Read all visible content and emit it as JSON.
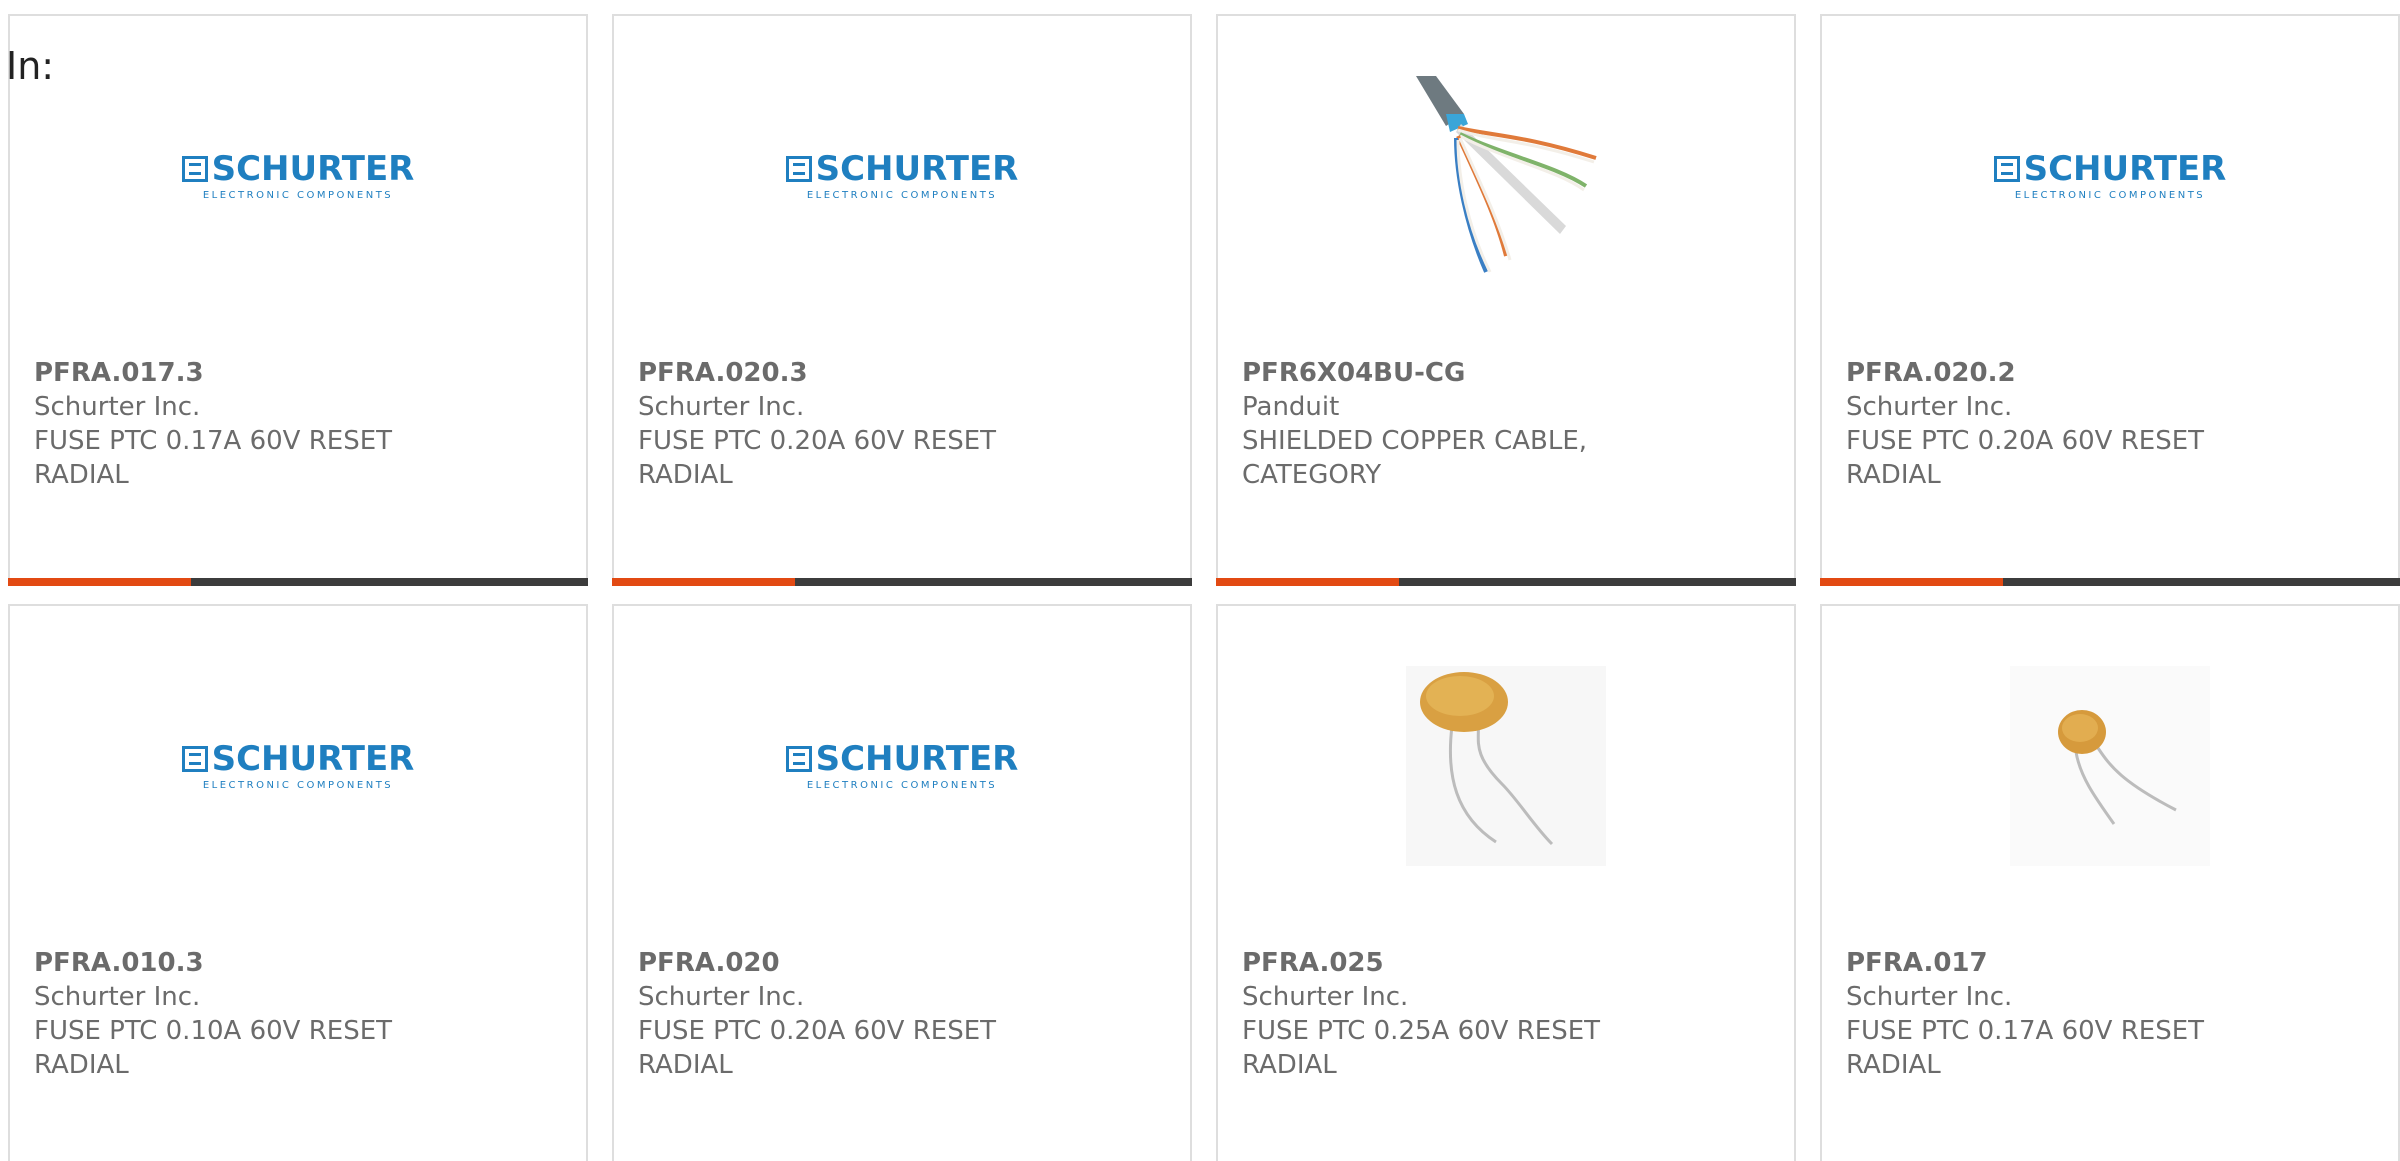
{
  "header": {
    "in_label": "In:"
  },
  "logo": {
    "name": "SCHURTER",
    "tagline": "ELECTRONIC COMPONENTS"
  },
  "colors": {
    "accent": "#e24a13",
    "bar": "#3c3c3c",
    "text": "#6b6b6b",
    "brand": "#1f7fc0"
  },
  "products": [
    {
      "part_number": "PFRA.017.3",
      "manufacturer": "Schurter Inc.",
      "description": "FUSE PTC 0.17A 60V RESET RADIAL",
      "image": "schurter-logo"
    },
    {
      "part_number": "PFRA.020.3",
      "manufacturer": "Schurter Inc.",
      "description": "FUSE PTC 0.20A 60V RESET RADIAL",
      "image": "schurter-logo"
    },
    {
      "part_number": "PFR6X04BU-CG",
      "manufacturer": "Panduit",
      "description": "SHIELDED COPPER CABLE, CATEGORY",
      "image": "cable-photo"
    },
    {
      "part_number": "PFRA.020.2",
      "manufacturer": "Schurter Inc.",
      "description": "FUSE PTC 0.20A 60V RESET RADIAL",
      "image": "schurter-logo"
    },
    {
      "part_number": "PFRA.010.3",
      "manufacturer": "Schurter Inc.",
      "description": "FUSE PTC 0.10A 60V RESET RADIAL",
      "image": "schurter-logo"
    },
    {
      "part_number": "PFRA.020",
      "manufacturer": "Schurter Inc.",
      "description": "FUSE PTC 0.20A 60V RESET RADIAL",
      "image": "schurter-logo"
    },
    {
      "part_number": "PFRA.025",
      "manufacturer": "Schurter Inc.",
      "description": "FUSE PTC 0.25A 60V RESET RADIAL",
      "image": "ptc-fuse-photo-large"
    },
    {
      "part_number": "PFRA.017",
      "manufacturer": "Schurter Inc.",
      "description": "FUSE PTC 0.17A 60V RESET RADIAL",
      "image": "ptc-fuse-photo-small"
    }
  ]
}
